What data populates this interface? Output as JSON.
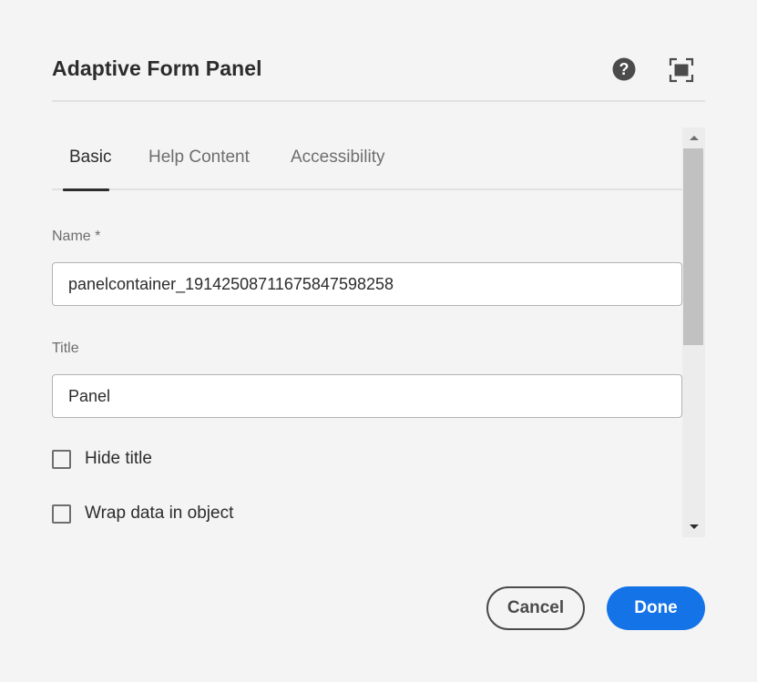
{
  "dialog": {
    "title": "Adaptive Form Panel",
    "icons": {
      "help": "help-circle-icon",
      "fullscreen": "fullscreen-icon"
    }
  },
  "tabs": [
    {
      "label": "Basic",
      "active": true
    },
    {
      "label": "Help Content",
      "active": false
    },
    {
      "label": "Accessibility",
      "active": false
    }
  ],
  "fields": {
    "name": {
      "label": "Name *",
      "value": "panelcontainer_1914250871167584759825​8"
    },
    "title": {
      "label": "Title",
      "value": "Panel"
    }
  },
  "checkboxes": {
    "hide_title": {
      "label": "Hide title",
      "checked": false
    },
    "wrap_data": {
      "label": "Wrap data in object",
      "checked": false
    }
  },
  "footer": {
    "cancel_label": "Cancel",
    "done_label": "Done"
  },
  "colors": {
    "accent": "#1473e6",
    "background": "#f4f4f4"
  }
}
